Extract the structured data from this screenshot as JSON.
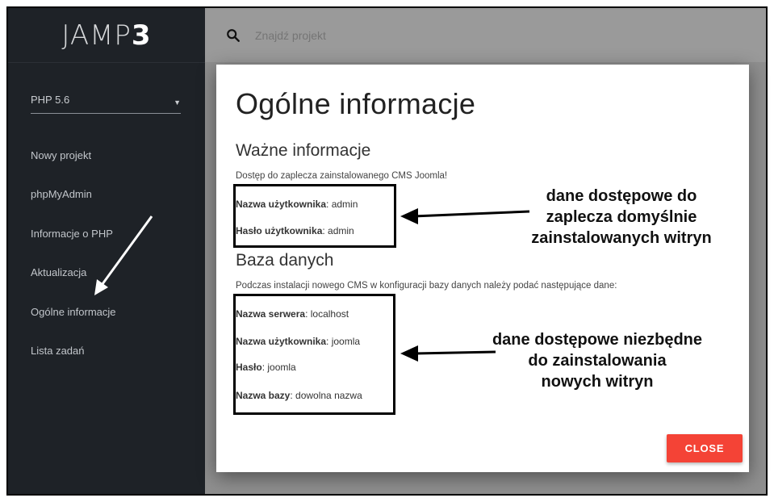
{
  "sidebar": {
    "logo_text": "JAMP",
    "logo_digit": "3",
    "php_version": "PHP 5.6",
    "items": [
      {
        "label": "Nowy projekt"
      },
      {
        "label": "phpMyAdmin"
      },
      {
        "label": "Informacje o PHP"
      },
      {
        "label": "Aktualizacja"
      },
      {
        "label": "Ogólne informacje"
      },
      {
        "label": "Lista zadań"
      }
    ]
  },
  "search": {
    "placeholder": "Znajdź projekt"
  },
  "modal": {
    "title": "Ogólne informacje",
    "important": {
      "heading": "Ważne informacje",
      "description": "Dostęp do zaplecza zainstalowanego CMS Joomla!",
      "fields": [
        {
          "key": "Nazwa użytkownika",
          "value": "admin"
        },
        {
          "key": "Hasło użytkownika",
          "value": "admin"
        }
      ]
    },
    "database": {
      "heading": "Baza danych",
      "description": "Podczas instalacji nowego CMS w konfiguracji bazy danych należy podać następujące dane:",
      "fields": [
        {
          "key": "Nazwa serwera",
          "value": "localhost"
        },
        {
          "key": "Nazwa użytkownika",
          "value": "joomla"
        },
        {
          "key": "Hasło",
          "value": "joomla"
        },
        {
          "key": "Nazwa bazy",
          "value": "dowolna nazwa"
        }
      ]
    },
    "close_label": "CLOSE"
  },
  "annotations": {
    "note1": [
      "dane dostępowe do",
      "zaplecza domyślnie",
      "zainstalowanych witryn"
    ],
    "note2": [
      "dane dostępowe niezbędne",
      "do zainstalowania",
      "nowych witryn"
    ]
  },
  "colors": {
    "sidebar_bg": "#1e2227",
    "accent_close": "#f44336",
    "overlay": "#8f8f8f"
  }
}
